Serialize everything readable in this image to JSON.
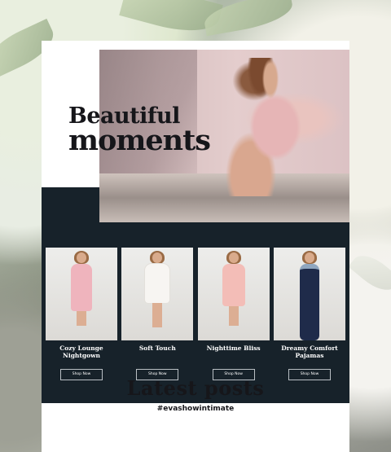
{
  "hero": {
    "title_line1": "Beautiful",
    "title_line2": "moments"
  },
  "products": [
    {
      "name": "Cozy Lounge Nightgown",
      "button": "Shop Now",
      "color": "#efb4bd"
    },
    {
      "name": "Soft Touch",
      "button": "Shop Now",
      "color": "#f7f5f2"
    },
    {
      "name": "Nighttime Bliss",
      "button": "Shop Now",
      "color": "#f3bdb7"
    },
    {
      "name": "Dreamy Comfort Pajamas",
      "button": "Shop Now",
      "color": "#1f2b4a"
    }
  ],
  "latest": {
    "title": "Latest posts",
    "hashtag": "#evashowintimate"
  },
  "colors": {
    "dark_band": "#17222a",
    "card": "#ffffff"
  }
}
